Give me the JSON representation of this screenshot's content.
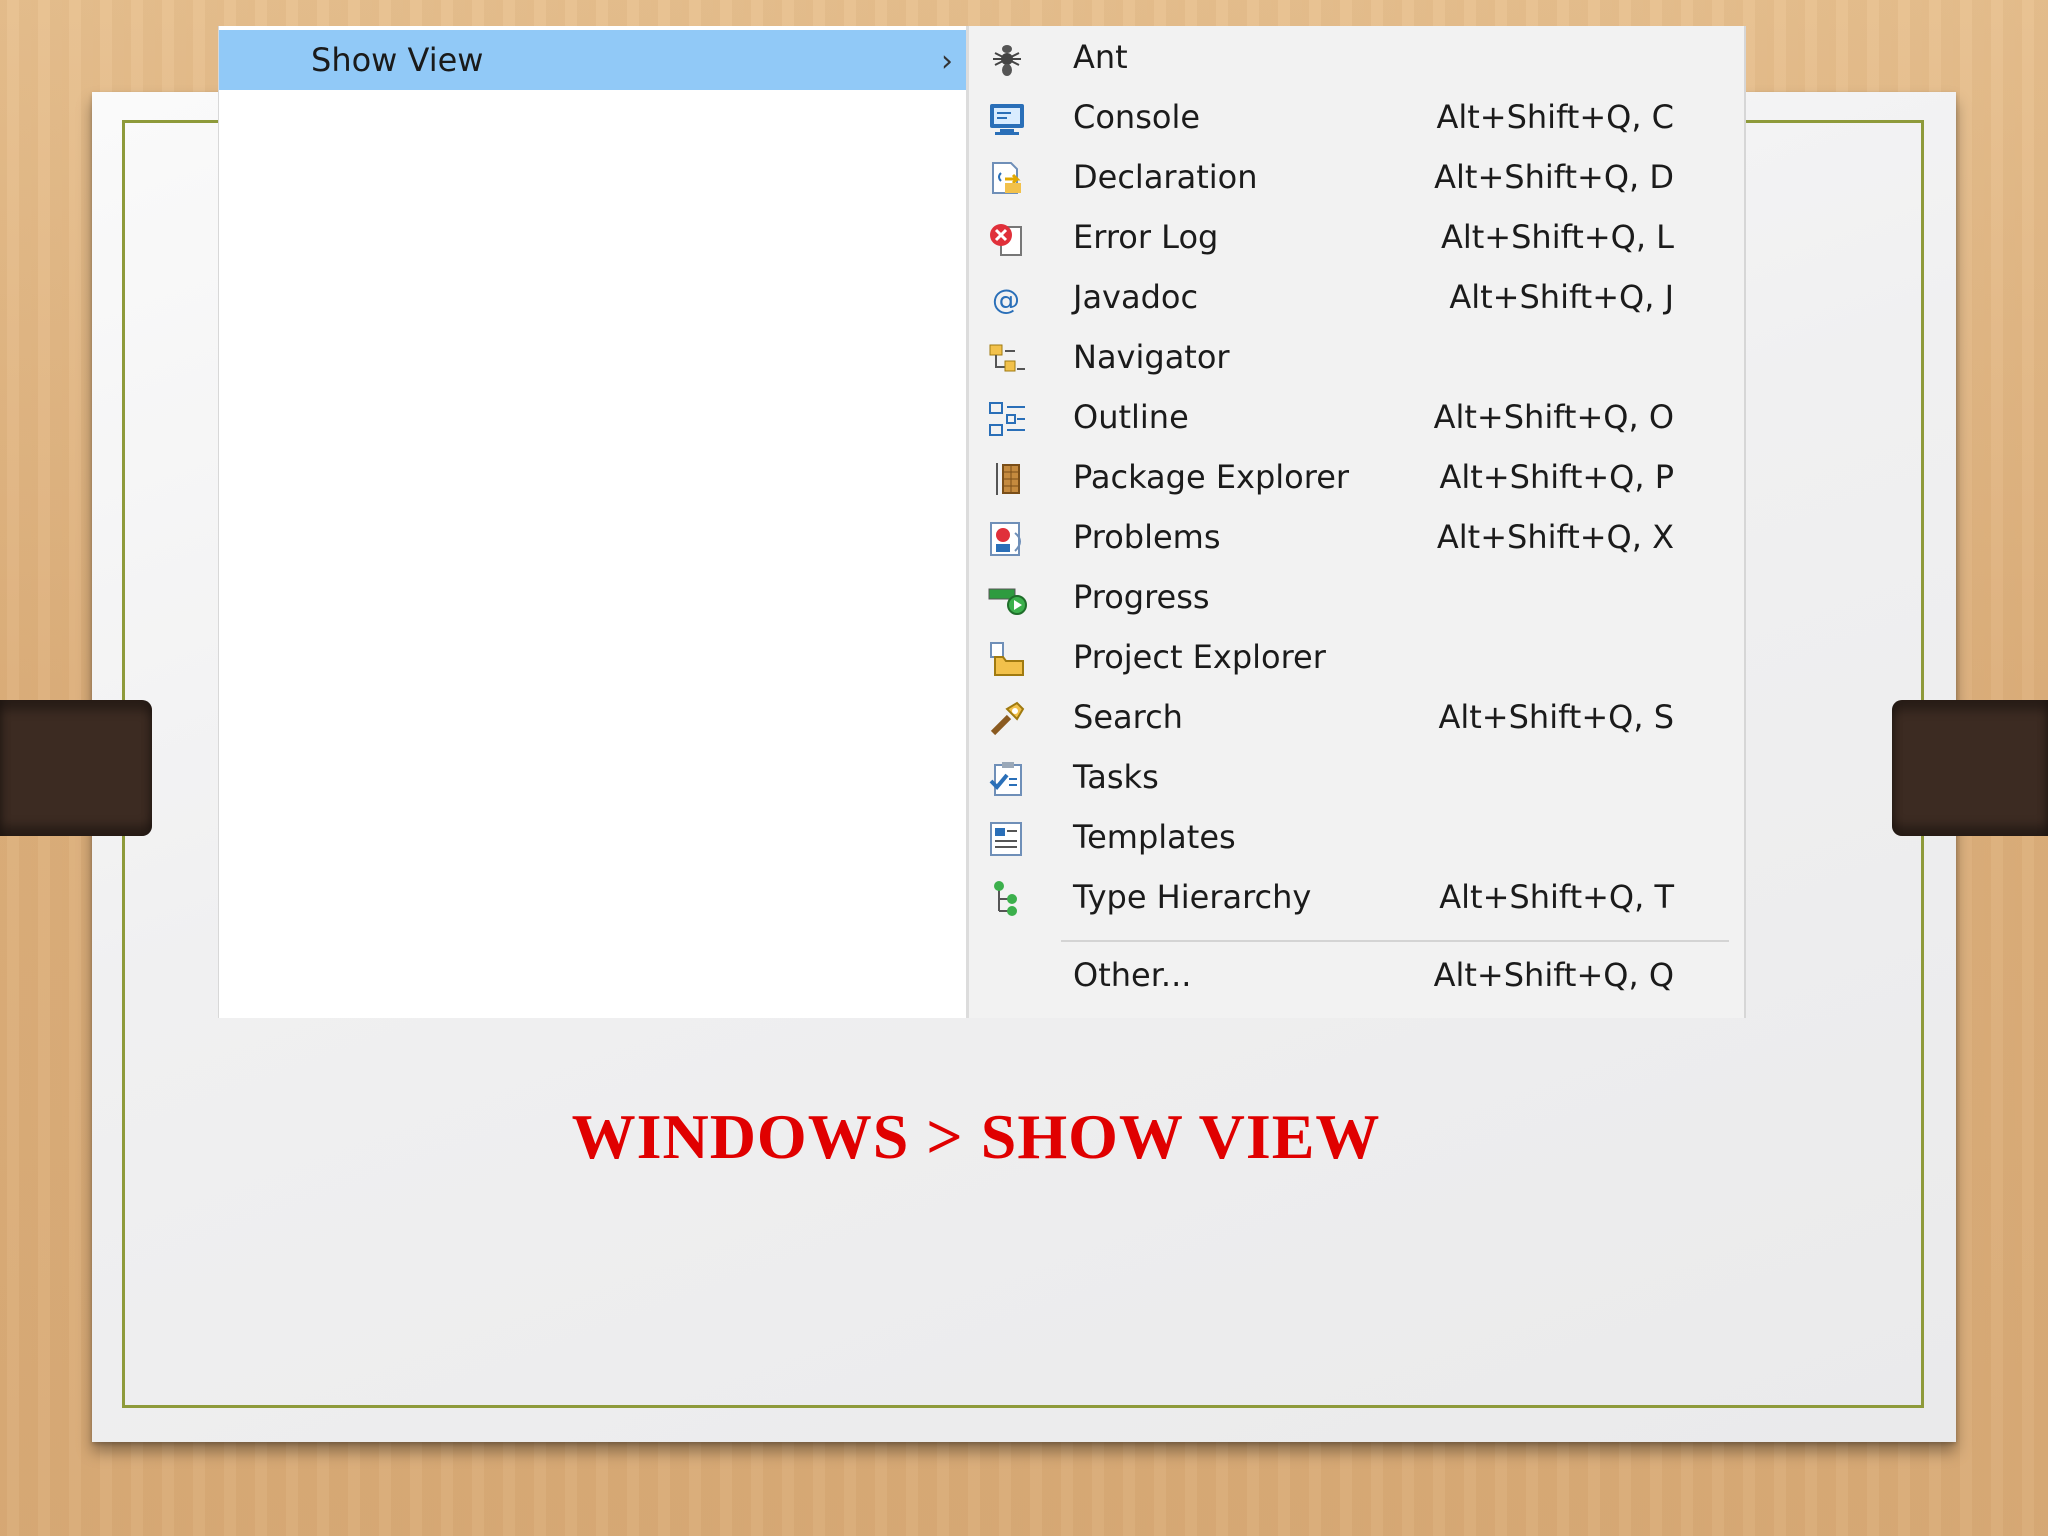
{
  "submenu_parent": {
    "label": "Show View",
    "chevron": "›"
  },
  "items": [
    {
      "label": "Ant",
      "shortcut": "",
      "icon": "ant-icon"
    },
    {
      "label": "Console",
      "shortcut": "Alt+Shift+Q, C",
      "icon": "console-icon"
    },
    {
      "label": "Declaration",
      "shortcut": "Alt+Shift+Q, D",
      "icon": "declaration-icon"
    },
    {
      "label": "Error Log",
      "shortcut": "Alt+Shift+Q, L",
      "icon": "error-log-icon"
    },
    {
      "label": "Javadoc",
      "shortcut": "Alt+Shift+Q, J",
      "icon": "javadoc-icon"
    },
    {
      "label": "Navigator",
      "shortcut": "",
      "icon": "navigator-icon"
    },
    {
      "label": "Outline",
      "shortcut": "Alt+Shift+Q, O",
      "icon": "outline-icon"
    },
    {
      "label": "Package Explorer",
      "shortcut": "Alt+Shift+Q, P",
      "icon": "package-explorer-icon"
    },
    {
      "label": "Problems",
      "shortcut": "Alt+Shift+Q, X",
      "icon": "problems-icon"
    },
    {
      "label": "Progress",
      "shortcut": "",
      "icon": "progress-icon"
    },
    {
      "label": "Project Explorer",
      "shortcut": "",
      "icon": "project-explorer-icon"
    },
    {
      "label": "Search",
      "shortcut": "Alt+Shift+Q, S",
      "icon": "search-icon"
    },
    {
      "label": "Tasks",
      "shortcut": "",
      "icon": "tasks-icon"
    },
    {
      "label": "Templates",
      "shortcut": "",
      "icon": "templates-icon"
    },
    {
      "label": "Type Hierarchy",
      "shortcut": "Alt+Shift+Q, T",
      "icon": "type-hierarchy-icon"
    }
  ],
  "other": {
    "label": "Other...",
    "shortcut": "Alt+Shift+Q, Q"
  },
  "caption": "WINDOWS > SHOW VIEW",
  "colors": {
    "highlight": "#91c9f7",
    "caption": "#e00000",
    "frame": "#8e9a3a"
  }
}
